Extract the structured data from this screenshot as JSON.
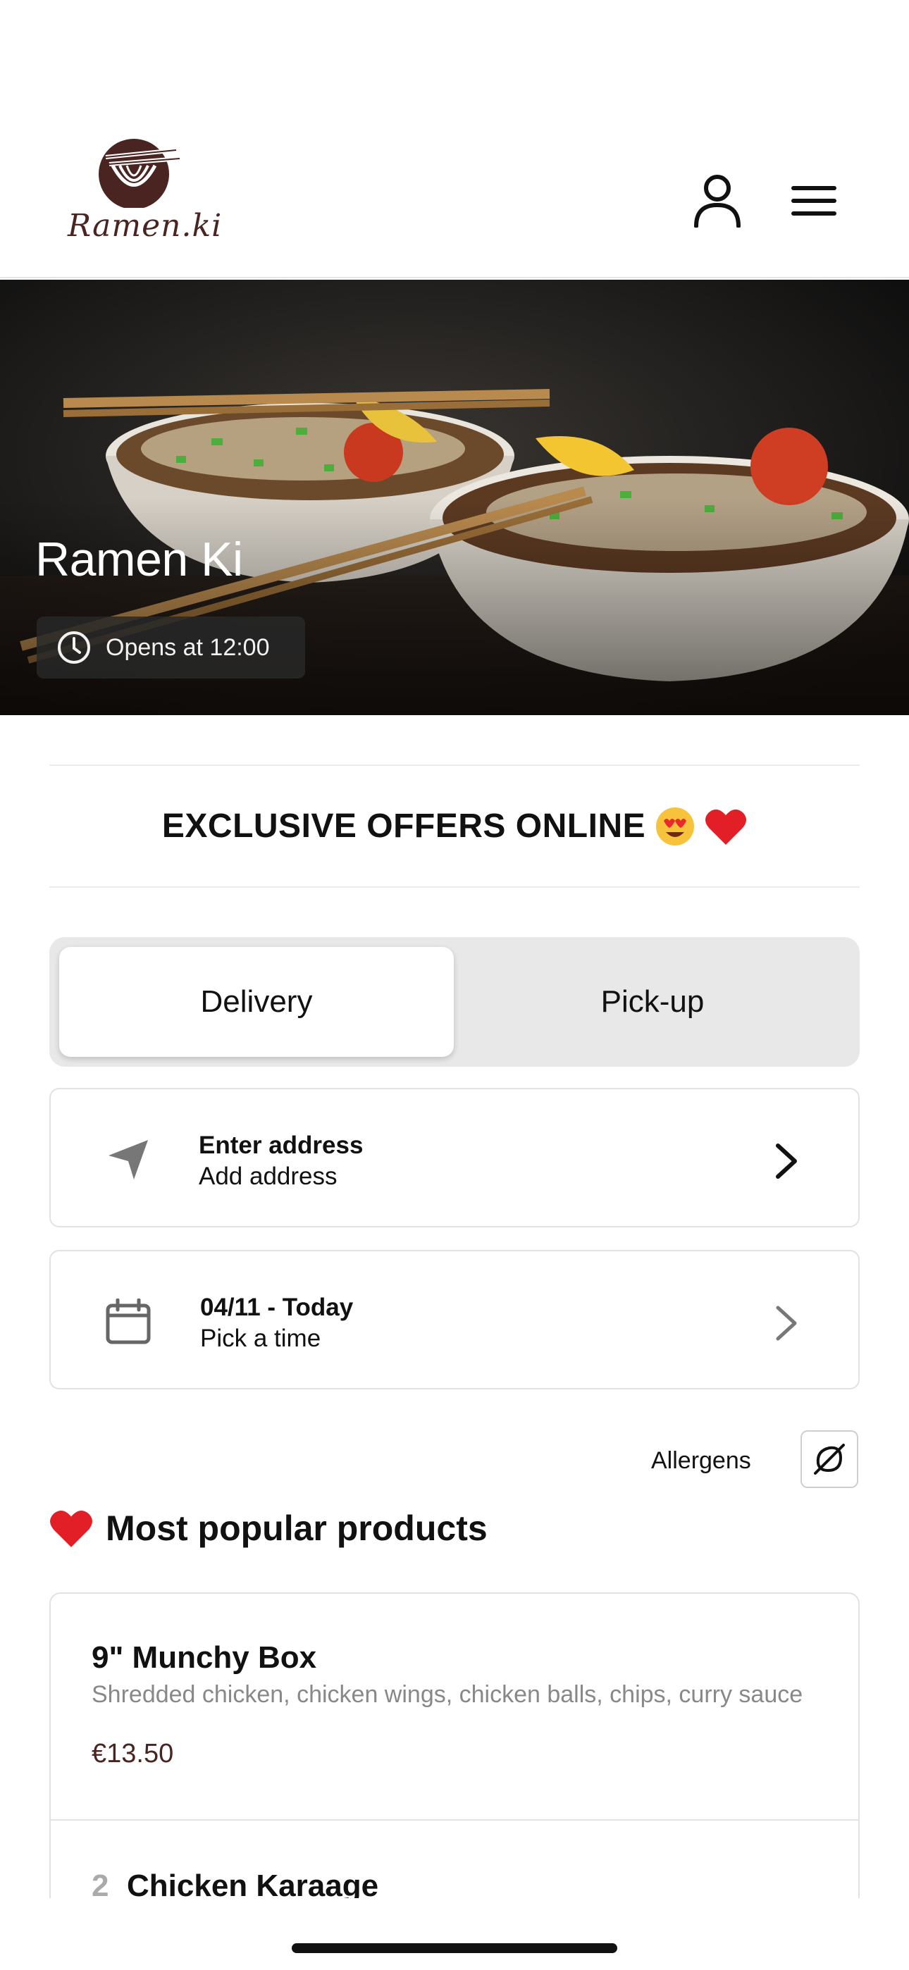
{
  "brand": {
    "name": "Ramen.ki",
    "color": "#4a2421"
  },
  "header": {
    "icons": [
      "user-icon",
      "menu-icon"
    ]
  },
  "hero": {
    "title": "Ramen Ki",
    "status": "Opens at 12:00",
    "status_icon": "clock-icon"
  },
  "offers": {
    "text": "EXCLUSIVE OFFERS ONLINE",
    "emojis": [
      "heart-eyes-emoji",
      "heart-emoji"
    ]
  },
  "fulfillment": {
    "options": [
      "Delivery",
      "Pick-up"
    ],
    "selected": "Delivery"
  },
  "address": {
    "title": "Enter address",
    "subtitle": "Add address",
    "icon": "location-arrow-icon"
  },
  "time": {
    "title": "04/11 - Today",
    "subtitle": "Pick a time",
    "icon": "calendar-icon"
  },
  "allergens": {
    "label": "Allergens",
    "icon": "allergen-filter-icon"
  },
  "section": {
    "title": "Most popular products"
  },
  "products": [
    {
      "name": "9\" Munchy Box",
      "description": "Shredded chicken, chicken wings, chicken balls, chips, curry sauce",
      "price": "€13.50"
    },
    {
      "number": "2",
      "name": "Chicken Karaage"
    }
  ]
}
